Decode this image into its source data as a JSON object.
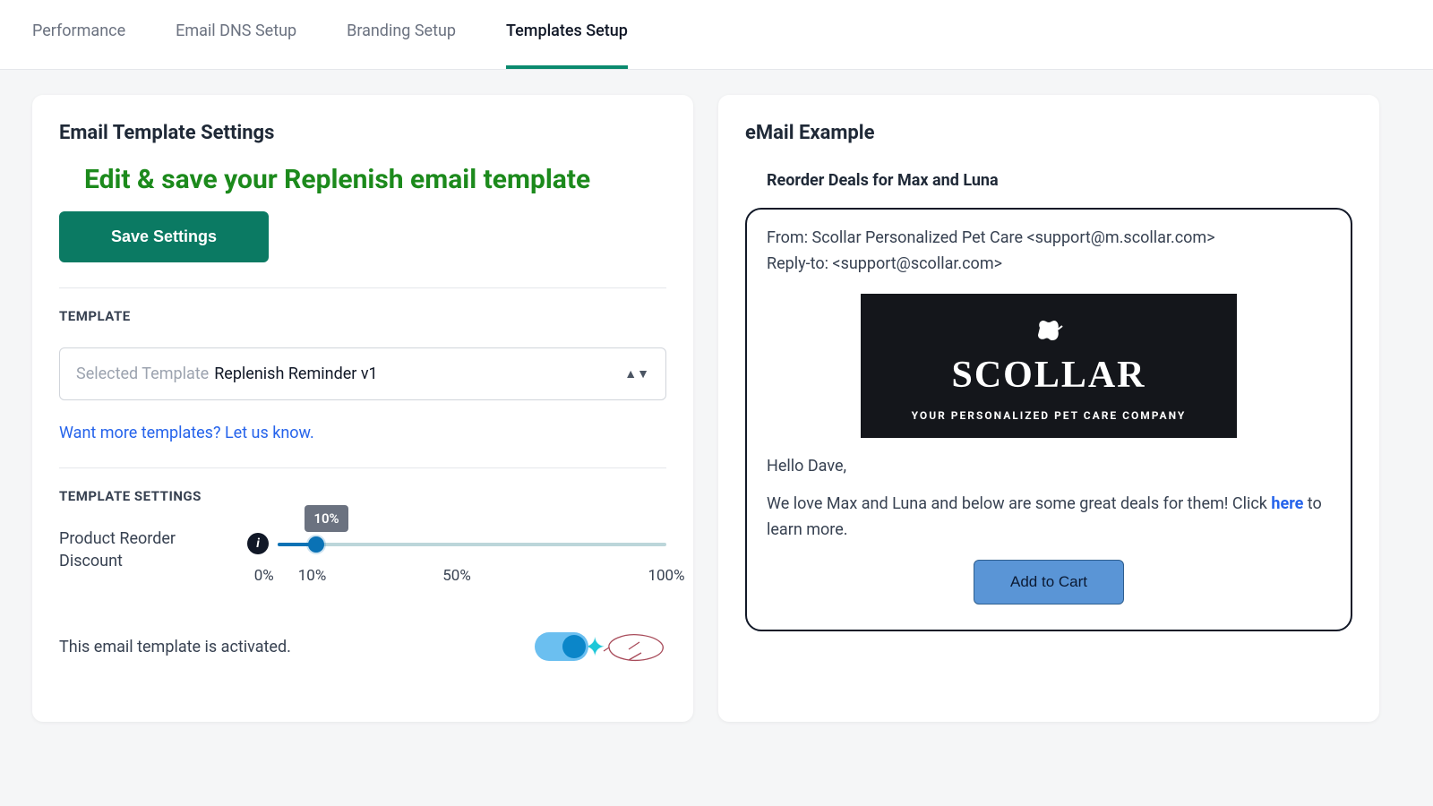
{
  "nav": {
    "items": [
      {
        "label": "Performance"
      },
      {
        "label": "Email DNS Setup"
      },
      {
        "label": "Branding Setup"
      },
      {
        "label": "Templates Setup"
      }
    ],
    "activeIndex": 3
  },
  "leftCard": {
    "title": "Email Template Settings",
    "headline": "Edit & save your Replenish email template",
    "saveBtn": "Save Settings",
    "templateSection": {
      "label": "TEMPLATE",
      "selectPrefix": "Selected Template",
      "selectValue": "Replenish Reminder v1",
      "moreLink": "Want more templates? Let us know."
    },
    "settingsSection": {
      "label": "TEMPLATE SETTINGS",
      "sliderLabel": "Product Reorder Discount",
      "sliderTooltip": "10%",
      "ticks": {
        "t0": "0%",
        "t10": "10%",
        "t50": "50%",
        "t100": "100%"
      },
      "activatedText": "This email template is activated."
    }
  },
  "rightCard": {
    "title": "eMail Example",
    "subject": "Reorder Deals for Max and Luna",
    "from": "From: Scollar Personalized Pet Care <support@m.scollar.com>",
    "replyTo": "Reply-to: <support@scollar.com>",
    "brand": {
      "name": "SCOLLAR",
      "tag": "YOUR PERSONALIZED PET CARE COMPANY"
    },
    "greeting": "Hello Dave,",
    "bodyBefore": "We love Max and Luna and below are some great deals for them! Click ",
    "bodyLink": "here",
    "bodyAfter": " to learn more.",
    "cartBtn": "Add to Cart"
  }
}
